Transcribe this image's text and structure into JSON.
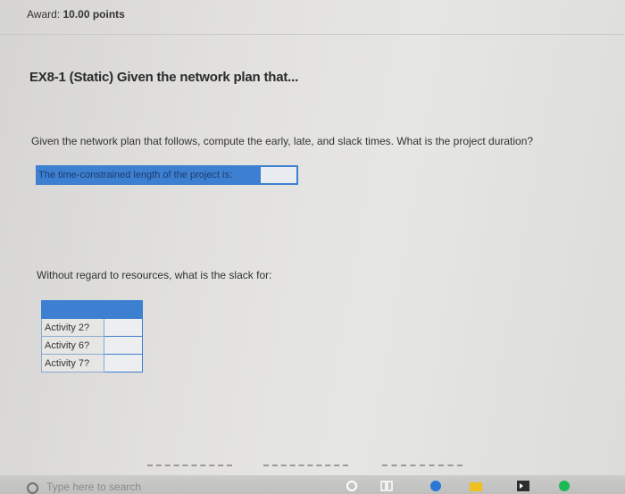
{
  "award": {
    "label": "Award:",
    "points": "10.00 points"
  },
  "title": "EX8-1 (Static) Given the network plan that...",
  "question": "Given the network plan that follows, compute the early, late, and slack times. What is the project duration?",
  "duration_prompt": {
    "label": "The time-constrained length of the project is:",
    "value": ""
  },
  "slack_question": "Without regard to resources, what is the slack for:",
  "slack_rows": [
    {
      "label": "Activity 2?",
      "value": ""
    },
    {
      "label": "Activity 6?",
      "value": ""
    },
    {
      "label": "Activity 7?",
      "value": ""
    }
  ],
  "taskbar": {
    "search_placeholder": "Type here to search"
  },
  "colors": {
    "accent": "#3d7fd0"
  }
}
